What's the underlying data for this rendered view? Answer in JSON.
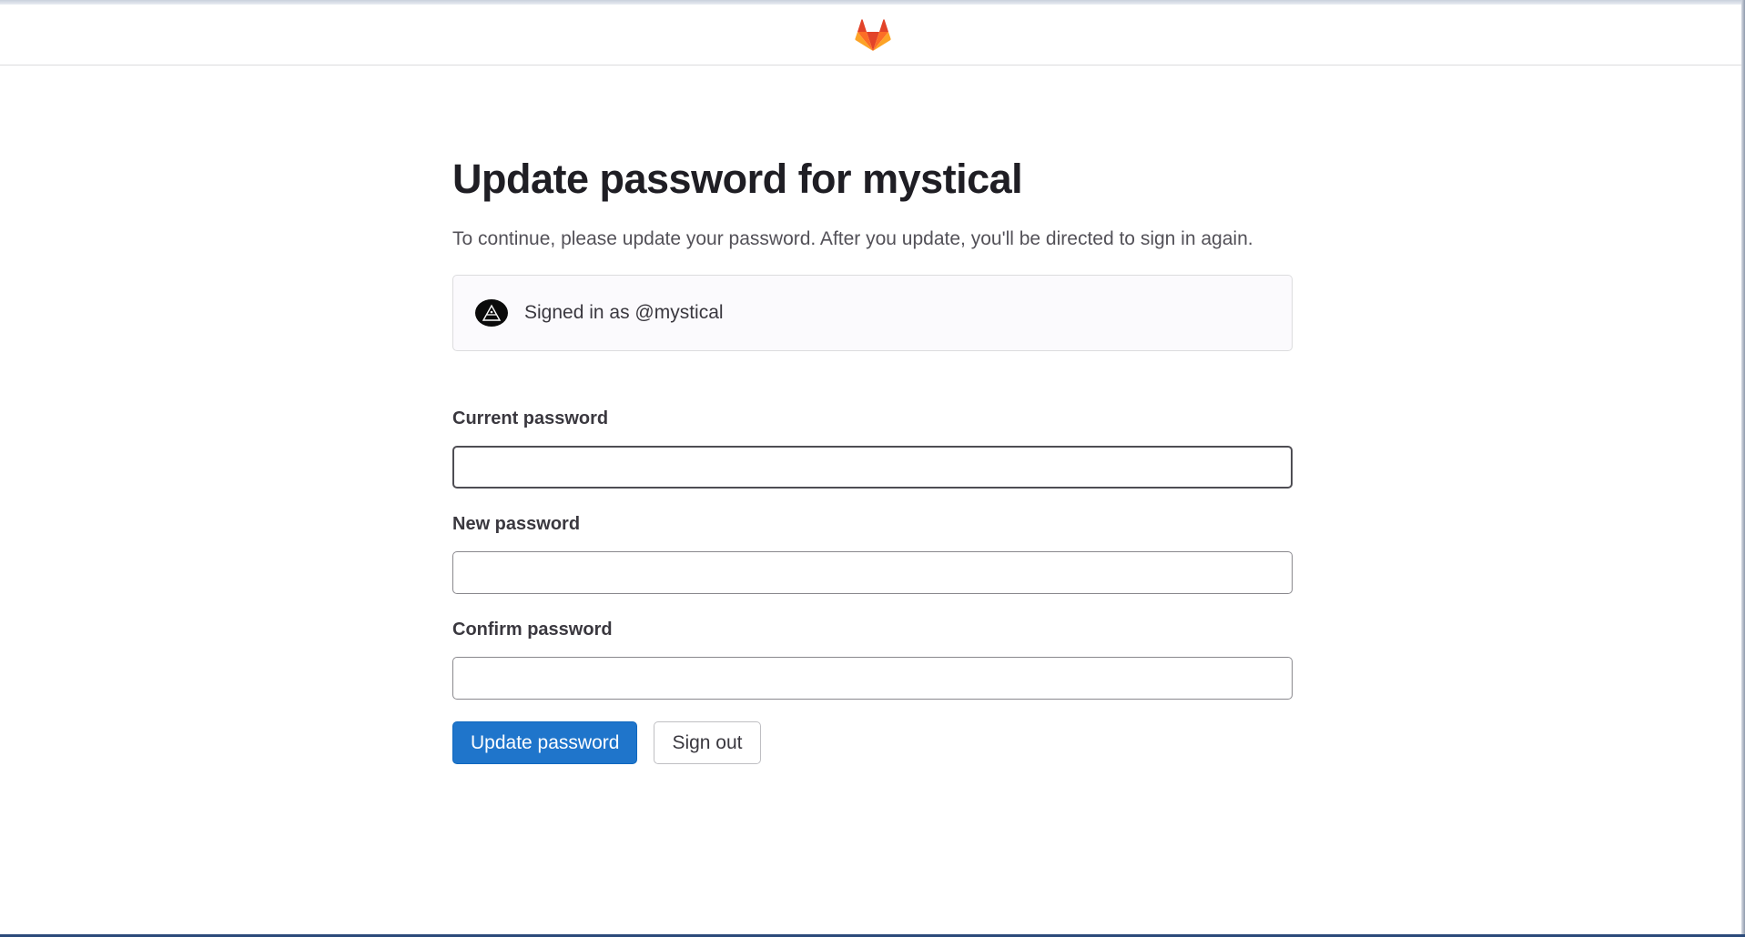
{
  "page": {
    "title": "Update password for mystical",
    "description": "To continue, please update your password. After you update, you'll be directed to sign in again."
  },
  "header": {
    "logo_icon": "gitlab-tanuki-icon",
    "colors": {
      "logo_primary": "#e24329",
      "logo_secondary": "#fc6d26",
      "logo_tertiary": "#fca326"
    }
  },
  "signed_in": {
    "label": "Signed in as @mystical",
    "avatar_icon": "user-avatar"
  },
  "form": {
    "current_password": {
      "label": "Current password",
      "value": "",
      "placeholder": ""
    },
    "new_password": {
      "label": "New password",
      "value": "",
      "placeholder": ""
    },
    "confirm_password": {
      "label": "Confirm password",
      "value": "",
      "placeholder": ""
    }
  },
  "actions": {
    "update_label": "Update password",
    "sign_out_label": "Sign out"
  },
  "colors": {
    "primary_button": "#1f75cb",
    "text": "#1f1e24",
    "muted_text": "#535158",
    "border": "#dcdcde"
  }
}
